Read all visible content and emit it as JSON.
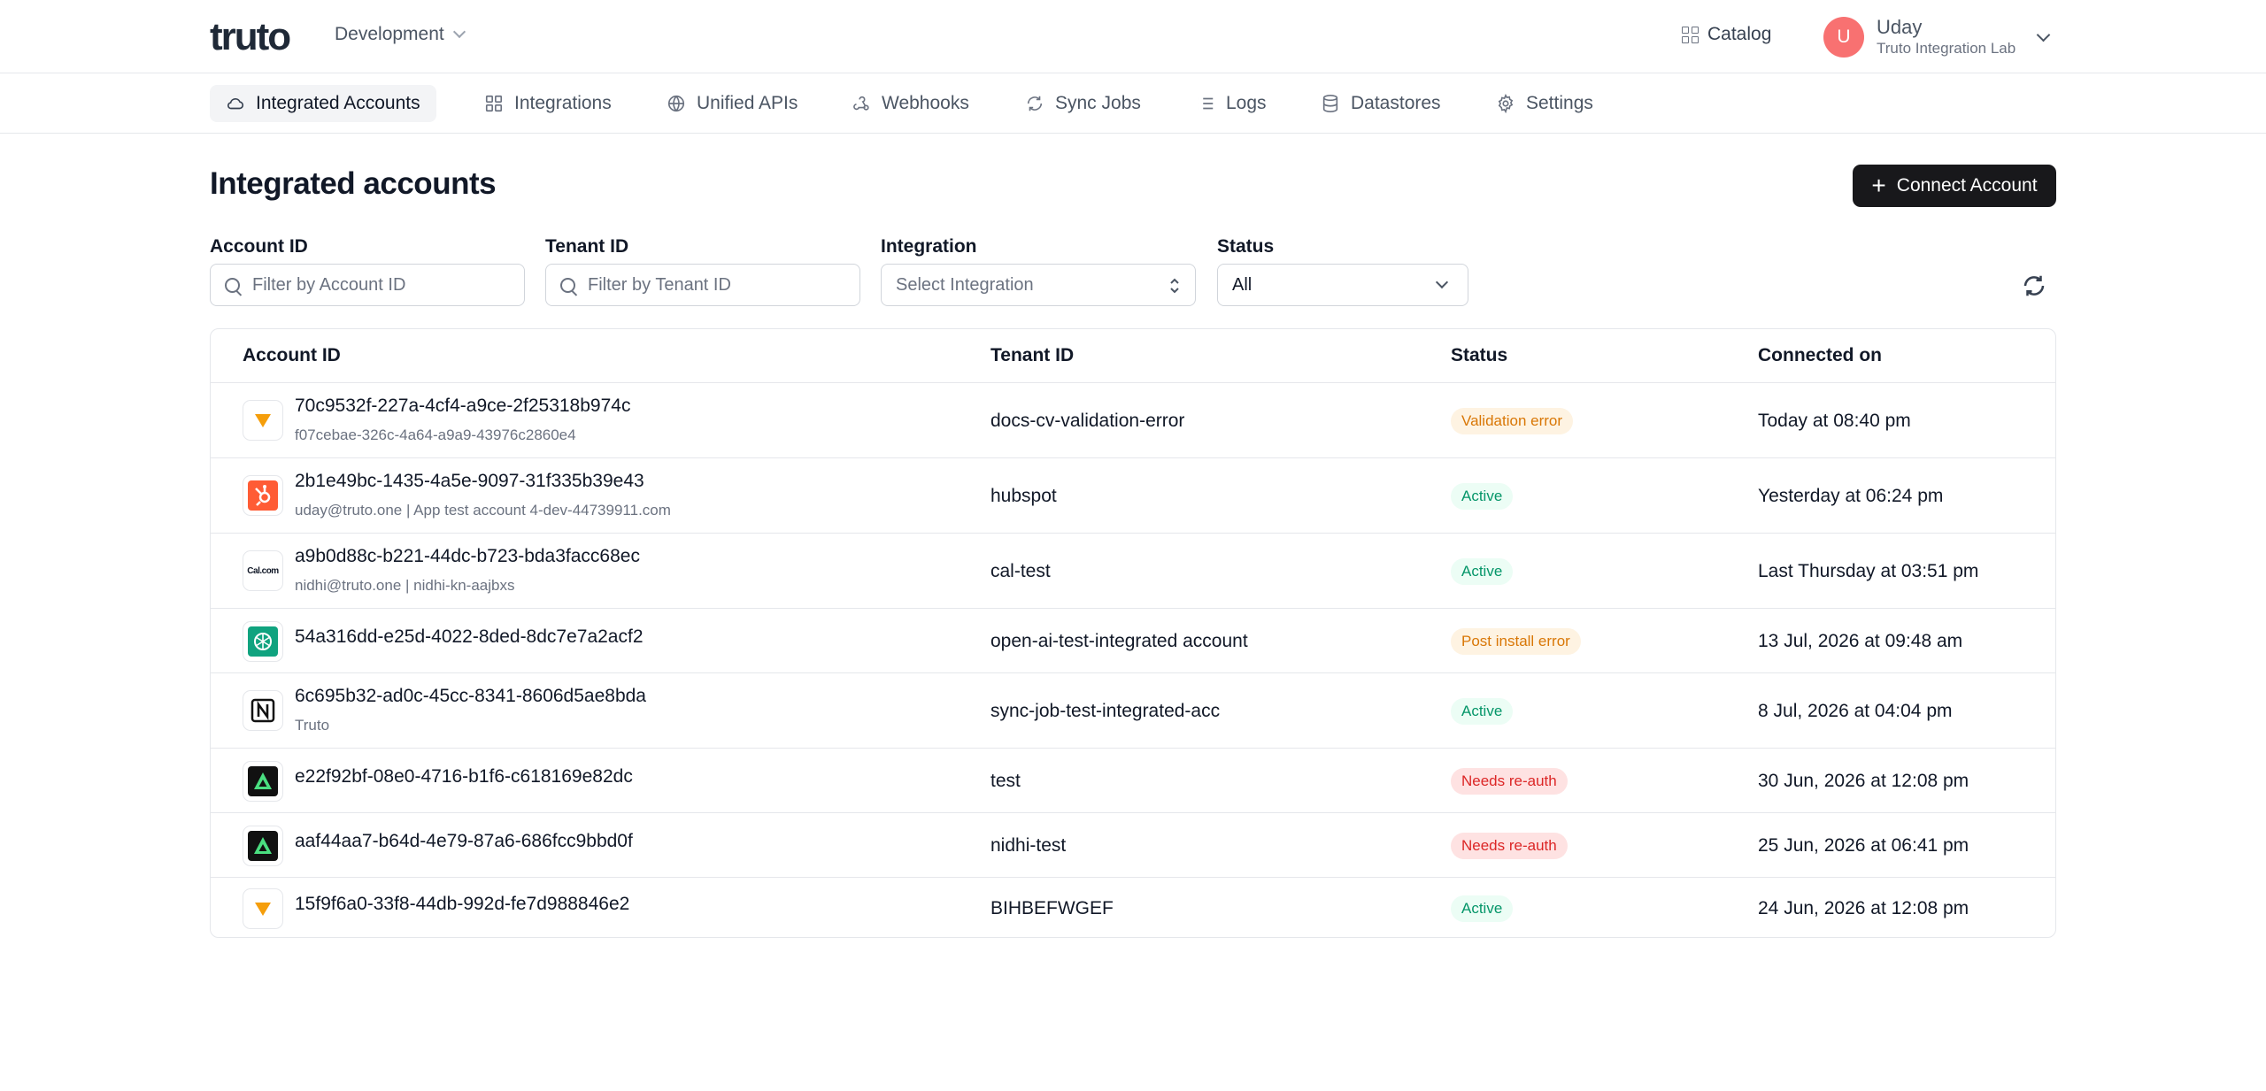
{
  "header": {
    "logo_text": "truto",
    "environment": "Development",
    "catalog_label": "Catalog",
    "user_initial": "U",
    "user_name": "Uday",
    "user_org": "Truto Integration Lab"
  },
  "nav": {
    "tabs": [
      {
        "label": "Integrated Accounts",
        "icon": "cloud-icon",
        "active": true
      },
      {
        "label": "Integrations",
        "icon": "grid-icon",
        "active": false
      },
      {
        "label": "Unified APIs",
        "icon": "globe-icon",
        "active": false
      },
      {
        "label": "Webhooks",
        "icon": "webhook-icon",
        "active": false
      },
      {
        "label": "Sync Jobs",
        "icon": "sync-icon",
        "active": false
      },
      {
        "label": "Logs",
        "icon": "list-icon",
        "active": false
      },
      {
        "label": "Datastores",
        "icon": "database-icon",
        "active": false
      },
      {
        "label": "Settings",
        "icon": "gear-icon",
        "active": false
      }
    ]
  },
  "page": {
    "title": "Integrated accounts",
    "connect_label": "Connect Account"
  },
  "filters": {
    "account_id_label": "Account ID",
    "account_id_placeholder": "Filter by Account ID",
    "tenant_id_label": "Tenant ID",
    "tenant_id_placeholder": "Filter by Tenant ID",
    "integration_label": "Integration",
    "integration_placeholder": "Select Integration",
    "status_label": "Status",
    "status_value": "All"
  },
  "table": {
    "columns": [
      "Account ID",
      "Tenant ID",
      "Status",
      "Connected on"
    ],
    "rows": [
      {
        "logo": "orange-triangle-logo",
        "account_id": "70c9532f-227a-4cf4-a9ce-2f25318b974c",
        "sub": "f07cebae-326c-4a64-a9a9-43976c2860e4",
        "tenant": "docs-cv-validation-error",
        "status": "Validation error",
        "status_kind": "warn",
        "connected": "Today at 08:40 pm"
      },
      {
        "logo": "hubspot-logo",
        "account_id": "2b1e49bc-1435-4a5e-9097-31f335b39e43",
        "sub": "uday@truto.one | App test account 4-dev-44739911.com",
        "tenant": "hubspot",
        "status": "Active",
        "status_kind": "active",
        "connected": "Yesterday at 06:24 pm"
      },
      {
        "logo": "calcom-logo",
        "logo_text": "Cal.com",
        "account_id": "a9b0d88c-b221-44dc-b723-bda3facc68ec",
        "sub": "nidhi@truto.one | nidhi-kn-aajbxs",
        "tenant": "cal-test",
        "status": "Active",
        "status_kind": "active",
        "connected": "Last Thursday at 03:51 pm"
      },
      {
        "logo": "openai-logo",
        "account_id": "54a316dd-e25d-4022-8ded-8dc7e7a2acf2",
        "sub": "",
        "tenant": "open-ai-test-integrated account",
        "status": "Post install error",
        "status_kind": "warn",
        "connected": "13 Jul, 2026 at 09:48 am"
      },
      {
        "logo": "notion-logo",
        "account_id": "6c695b32-ad0c-45cc-8341-8606d5ae8bda",
        "sub": "Truto",
        "tenant": "sync-job-test-integrated-acc",
        "status": "Active",
        "status_kind": "active",
        "connected": "8 Jul, 2026 at 04:04 pm"
      },
      {
        "logo": "green-triangle-logo",
        "account_id": "e22f92bf-08e0-4716-b1f6-c618169e82dc",
        "sub": "",
        "tenant": "test",
        "status": "Needs re-auth",
        "status_kind": "err",
        "connected": "30 Jun, 2026 at 12:08 pm"
      },
      {
        "logo": "green-triangle-logo",
        "account_id": "aaf44aa7-b64d-4e79-87a6-686fcc9bbd0f",
        "sub": "",
        "tenant": "nidhi-test",
        "status": "Needs re-auth",
        "status_kind": "err",
        "connected": "25 Jun, 2026 at 06:41 pm"
      },
      {
        "logo": "orange-triangle-logo",
        "account_id": "15f9f6a0-33f8-44db-992d-fe7d988846e2",
        "sub": "",
        "tenant": "BIHBEFWGEF",
        "status": "Active",
        "status_kind": "active",
        "connected": "24 Jun, 2026 at 12:08 pm"
      }
    ]
  },
  "colors": {
    "primary_button": "#18181b",
    "active_badge": "#059669",
    "warn_badge": "#d97706",
    "error_badge": "#dc2626",
    "avatar": "#f87171"
  }
}
